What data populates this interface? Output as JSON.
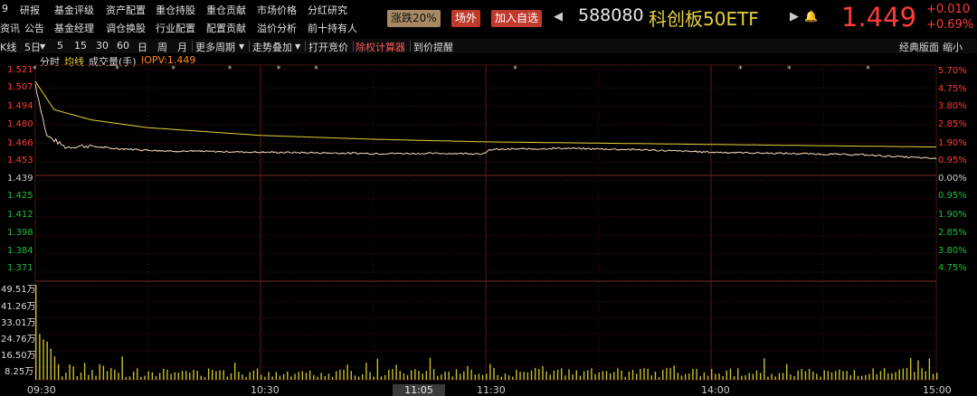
{
  "menu_row1": [
    "9",
    "研报",
    "基金评级",
    "资产配置",
    "重仓持股",
    "重仓贡献",
    "市场价格",
    "分红研究"
  ],
  "menu_row2": [
    "资讯",
    "公告",
    "基金经理",
    "调仓换股",
    "行业配置",
    "配置贡献",
    "溢价分析",
    "前十持有人"
  ],
  "header": {
    "badge_limit": "涨跌20%",
    "badge_offmarket": "场外",
    "badge_add": "加入自选",
    "code": "588080",
    "name": "科创板50ETF",
    "price": "1.449",
    "change": "+0.010",
    "change_pct": "+0.69%"
  },
  "toolbar": {
    "items": [
      "K线",
      "5日",
      "5",
      "15",
      "30",
      "60",
      "日",
      "周",
      "月",
      "更多周期",
      "走势叠加",
      "打开竞价",
      "除权计算器",
      "到价提醒"
    ],
    "right": [
      "经典版面",
      "缩小"
    ]
  },
  "legend": {
    "time": "分时",
    "avg": "均线",
    "vol": "成交量(手)",
    "iopv": "IOPV:1.449"
  },
  "colors": {
    "up": "#ff3b3b",
    "down": "#1fbf3f",
    "price": "#e8e8e8",
    "avg": "#e6d23a",
    "iopv": "#ff8a1e",
    "vol": "#c8bf2a",
    "grid": "#4a1414"
  },
  "chart_data": {
    "type": "line",
    "x_ticks": [
      "09:30",
      "10:30",
      "11:05",
      "11:30",
      "14:00",
      "15:00"
    ],
    "y_price_ticks": [
      "1.521",
      "1.507",
      "1.494",
      "1.480",
      "1.466",
      "1.453",
      "1.439",
      "1.425",
      "1.412",
      "1.398",
      "1.384",
      "1.371"
    ],
    "y_pct_ticks": [
      "5.70%",
      "4.75%",
      "3.80%",
      "2.85%",
      "1.90%",
      "0.95%",
      "0.00%",
      "0.95%",
      "1.90%",
      "2.85%",
      "3.80%",
      "4.75%"
    ],
    "y_vol_ticks": [
      "49.51万",
      "41.26万",
      "33.01万",
      "24.76万",
      "16.50万",
      "8.25万"
    ],
    "prev_close": 1.439,
    "ylim": [
      1.364,
      1.521
    ],
    "series": [
      {
        "name": "分时",
        "points": [
          [
            0,
            1.51
          ],
          [
            3,
            1.47
          ],
          [
            8,
            1.461
          ],
          [
            14,
            1.462
          ],
          [
            20,
            1.46
          ],
          [
            35,
            1.458
          ],
          [
            60,
            1.457
          ],
          [
            90,
            1.456
          ],
          [
            120,
            1.456
          ],
          [
            121,
            1.459
          ],
          [
            140,
            1.46
          ],
          [
            160,
            1.459
          ],
          [
            180,
            1.457
          ],
          [
            200,
            1.456
          ],
          [
            220,
            1.455
          ],
          [
            240,
            1.452
          ]
        ]
      },
      {
        "name": "均线",
        "points": [
          [
            0,
            1.512
          ],
          [
            5,
            1.49
          ],
          [
            15,
            1.482
          ],
          [
            30,
            1.476
          ],
          [
            60,
            1.47
          ],
          [
            90,
            1.467
          ],
          [
            120,
            1.465
          ],
          [
            150,
            1.464
          ],
          [
            180,
            1.463
          ],
          [
            210,
            1.462
          ],
          [
            240,
            1.461
          ]
        ]
      }
    ]
  }
}
